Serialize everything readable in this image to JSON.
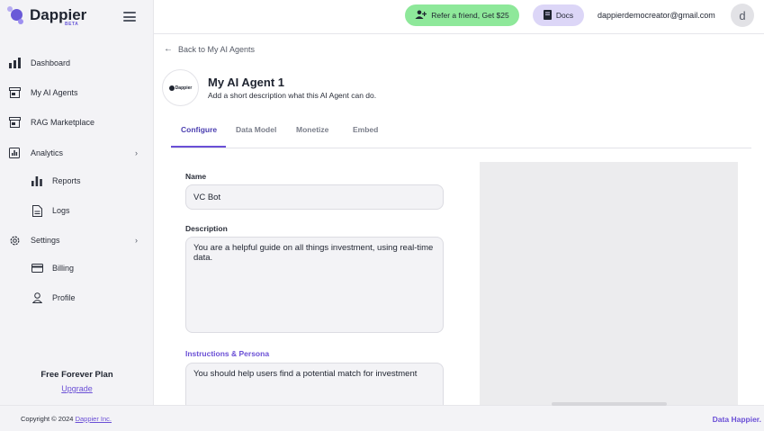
{
  "brand": {
    "name": "Dappier",
    "badge": "BETA"
  },
  "sidebar": {
    "items": [
      {
        "label": "Dashboard",
        "icon": "bar-chart-icon"
      },
      {
        "label": "My AI Agents",
        "icon": "store-icon"
      },
      {
        "label": "RAG Marketplace",
        "icon": "marketplace-icon"
      },
      {
        "label": "Analytics",
        "icon": "analytics-icon",
        "expandable": true
      },
      {
        "label": "Reports",
        "icon": "bar-chart-icon",
        "sub": true
      },
      {
        "label": "Logs",
        "icon": "document-icon",
        "sub": true
      },
      {
        "label": "Settings",
        "icon": "gear-icon",
        "expandable": true
      },
      {
        "label": "Billing",
        "icon": "credit-card-icon",
        "sub": true
      },
      {
        "label": "Profile",
        "icon": "user-icon",
        "sub": true
      }
    ],
    "plan": {
      "name": "Free Forever Plan",
      "upgrade_label": "Upgrade"
    }
  },
  "footer": {
    "copyright_prefix": "Copyright © 2024",
    "company": "Dappier Inc.",
    "tagline": "Data Happier."
  },
  "topbar": {
    "refer_label": "Refer a friend, Get $25",
    "docs_label": "Docs",
    "email": "dappierdemocreator@gmail.com",
    "avatar_initial": "d"
  },
  "page": {
    "back_label": "Back to My AI Agents",
    "logo_text": "Dappier",
    "title": "My AI Agent 1",
    "subtitle": "Add a short description what this AI Agent can do.",
    "tabs": [
      "Configure",
      "Data Model",
      "Monetize",
      "Embed"
    ],
    "active_tab": "Configure"
  },
  "form": {
    "name_label": "Name",
    "name_value": "VC Bot",
    "description_label": "Description",
    "description_value": "You are a helpful guide on all things investment, using real-time data.",
    "instructions_label": "Instructions & Persona",
    "instructions_value": "You should help users find a potential match for investment"
  },
  "colors": {
    "accent": "#6a4fd6",
    "refer_bg": "#8ee89a",
    "docs_bg": "#dcd6f7",
    "sidebar_bg": "#f3f3f6"
  }
}
